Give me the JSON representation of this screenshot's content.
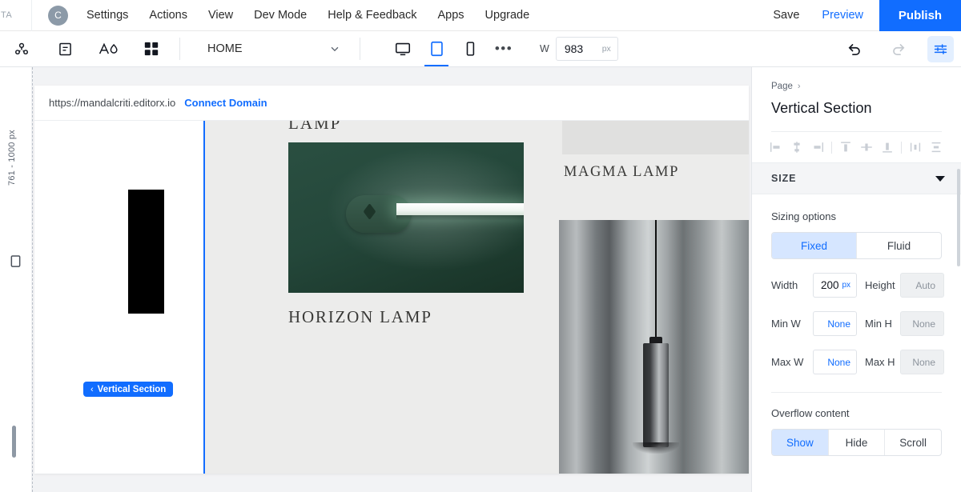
{
  "topbar": {
    "corner_logo": "TA",
    "avatar_initial": "C",
    "menu": [
      {
        "label": "Settings"
      },
      {
        "label": "Actions"
      },
      {
        "label": "View"
      },
      {
        "label": "Dev Mode"
      },
      {
        "label": "Help & Feedback"
      },
      {
        "label": "Apps"
      },
      {
        "label": "Upgrade"
      }
    ],
    "save_label": "Save",
    "preview_label": "Preview",
    "publish_label": "Publish"
  },
  "toolbar": {
    "icons": [
      {
        "name": "layers-icon"
      },
      {
        "name": "pages-icon"
      },
      {
        "name": "text-theme-icon"
      },
      {
        "name": "add-elements-icon"
      }
    ],
    "page_selector": "HOME",
    "devices": [
      {
        "name": "desktop",
        "selected": false
      },
      {
        "name": "tablet",
        "selected": true
      },
      {
        "name": "mobile",
        "selected": false
      }
    ],
    "more_label": "•••",
    "width_label": "W",
    "width_value": "983",
    "width_unit": "px"
  },
  "rail": {
    "breakpoint_label": "761 - 1000 px"
  },
  "canvas": {
    "url": "https://mandalcriti.editorx.io",
    "connect_domain": "Connect Domain",
    "selection_badge": "Vertical Section",
    "selection_chevron": "‹",
    "content": {
      "cut_title": "LAMP",
      "horizon_caption": "HORIZON LAMP",
      "magma_caption": "MAGMA LAMP"
    }
  },
  "panel": {
    "breadcrumb": "Page",
    "breadcrumb_chevron": "›",
    "title": "Vertical Section",
    "align_icons": [
      "align-left-icon",
      "align-center-horizontal-icon",
      "align-right-icon",
      "align-top-icon",
      "align-center-vertical-icon",
      "align-bottom-icon",
      "distribute-horizontal-icon",
      "distribute-vertical-icon"
    ],
    "size_section": {
      "header": "SIZE",
      "sizing_options_label": "Sizing options",
      "mode": [
        {
          "label": "Fixed",
          "selected": true
        },
        {
          "label": "Fluid",
          "selected": false
        }
      ],
      "width_label": "Width",
      "width_value": "200",
      "width_unit": "px",
      "height_label": "Height",
      "height_value": "Auto",
      "min_w_label": "Min W",
      "min_w_value": "None",
      "min_h_label": "Min H",
      "min_h_value": "None",
      "max_w_label": "Max W",
      "max_w_value": "None",
      "max_h_label": "Max H",
      "max_h_value": "None",
      "overflow_label": "Overflow content",
      "overflow_options": [
        {
          "label": "Show",
          "selected": true
        },
        {
          "label": "Hide",
          "selected": false
        },
        {
          "label": "Scroll",
          "selected": false
        }
      ]
    }
  },
  "colors": {
    "accent": "#116dff",
    "accent_soft": "#d6e6ff",
    "panel_bg": "#ffffff",
    "canvas_bg": "#f2f3f5",
    "section_header_bg": "#f4f5f7"
  }
}
